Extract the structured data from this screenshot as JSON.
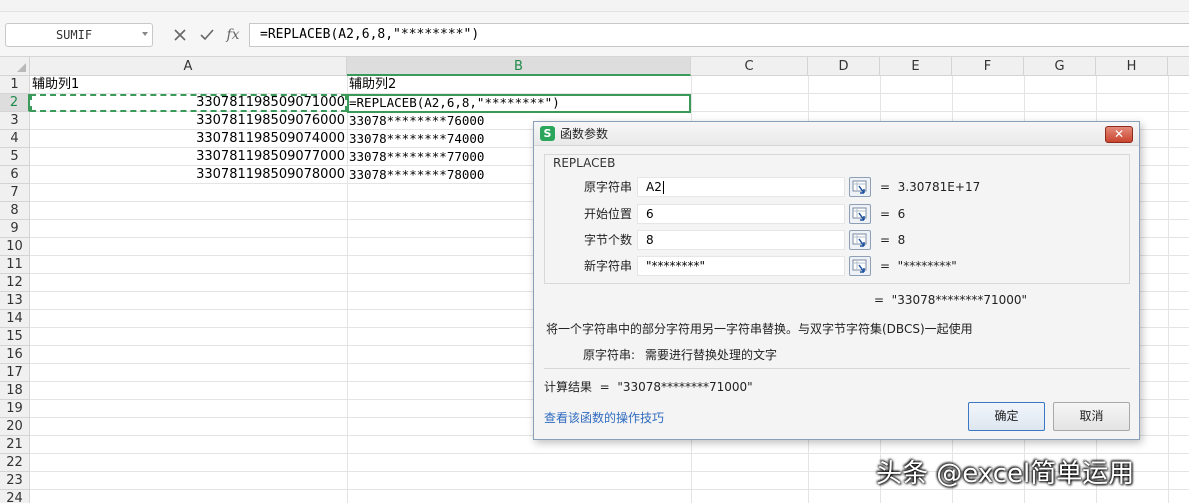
{
  "formula_bar": {
    "name_box": "SUMIF",
    "cancel_icon": "x-icon",
    "enter_icon": "check-icon",
    "fx_label": "fx",
    "formula": "=REPLACEB(A2,6,8,\"********\")"
  },
  "grid": {
    "columns": [
      "A",
      "B",
      "C",
      "D",
      "E",
      "F",
      "G",
      "H"
    ],
    "rows": [
      "1",
      "2",
      "3",
      "4",
      "5",
      "6",
      "7",
      "8",
      "9",
      "10",
      "11",
      "12",
      "13",
      "14",
      "15",
      "16",
      "17",
      "18",
      "19",
      "20",
      "21",
      "22",
      "23",
      "24"
    ],
    "selected_column": "B",
    "selected_row": "2",
    "cells": {
      "A1": "辅助列1",
      "B1": "辅助列2",
      "A2": "330781198509071000",
      "B2": "=REPLACEB(A2,6,8,\"********\")",
      "A3": "330781198509076000",
      "B3": "33078********76000",
      "A4": "330781198509074000",
      "B4": "33078********74000",
      "A5": "330781198509077000",
      "B5": "33078********77000",
      "A6": "330781198509078000",
      "B6": "33078********78000"
    }
  },
  "dialog": {
    "title": "函数参数",
    "app_icon": "S",
    "close_label": "✕",
    "function_name": "REPLACEB",
    "args": [
      {
        "label": "原字符串",
        "value": "A2",
        "result": "=  3.30781E+17"
      },
      {
        "label": "开始位置",
        "value": "6",
        "result": "=  6"
      },
      {
        "label": "字节个数",
        "value": "8",
        "result": "=  8"
      },
      {
        "label": "新字符串",
        "value": "\"********\"",
        "result": "=  \"********\""
      }
    ],
    "formula_result": "=  \"33078********71000\"",
    "description": "将一个字符串中的部分字符用另一字符串替换。与双字节字符集(DBCS)一起使用",
    "param_help_label": "原字符串:",
    "param_help_text": "需要进行替换处理的文字",
    "calc_result": "计算结果  =  \"33078********71000\"",
    "help_link": "查看该函数的操作技巧",
    "ok_label": "确定",
    "cancel_label": "取消"
  },
  "watermark": "头条 @excel简单运用"
}
